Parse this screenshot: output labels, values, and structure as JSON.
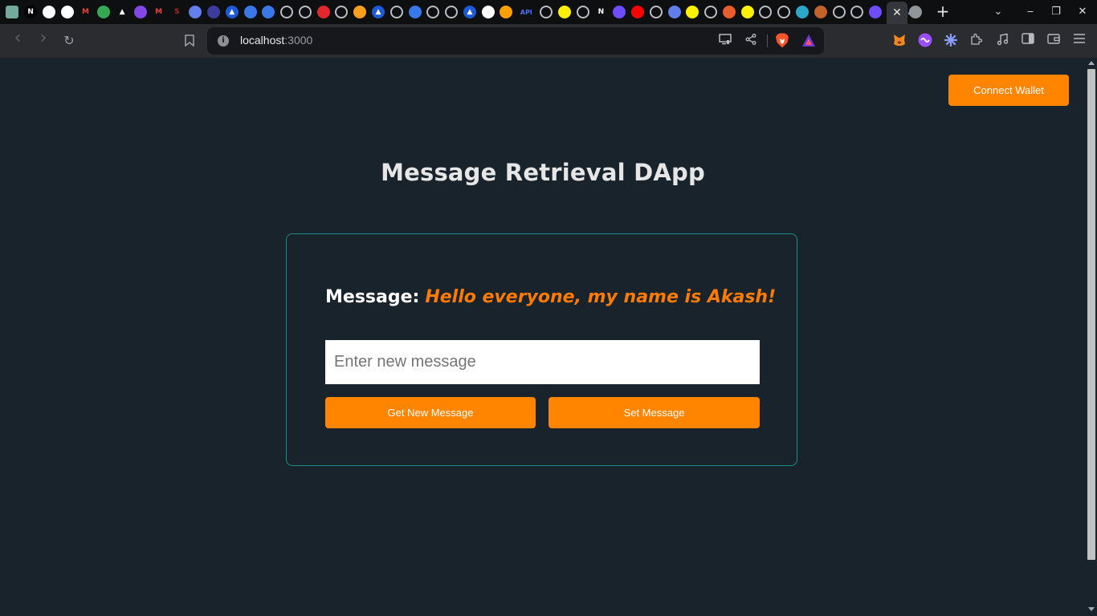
{
  "browser": {
    "tabs": {
      "favicons": [
        {
          "icon": "chatgpt-icon",
          "color": "#74aa9c",
          "glyph": ""
        },
        {
          "icon": "nextjs-icon",
          "color": "#000000",
          "glyph": "N"
        },
        {
          "icon": "github-icon",
          "color": "#ffffff",
          "glyph": ""
        },
        {
          "icon": "github-icon",
          "color": "#ffffff",
          "glyph": ""
        },
        {
          "icon": "gmail-icon",
          "color": "#ea4335",
          "glyph": "M"
        },
        {
          "icon": "chrome-dev-icon",
          "color": "#34a853",
          "glyph": ""
        },
        {
          "icon": "arweave-icon",
          "color": "#222222",
          "glyph": "▲"
        },
        {
          "icon": "polygon-icon",
          "color": "#8247e5",
          "glyph": ""
        },
        {
          "icon": "gmail-icon",
          "color": "#ea4335",
          "glyph": "M"
        },
        {
          "icon": "solidity-icon",
          "color": "#a52a2a",
          "glyph": "S"
        },
        {
          "icon": "ethereum-icon",
          "color": "#627eea",
          "glyph": ""
        },
        {
          "icon": "ethereum-icon",
          "color": "#3c3c9c",
          "glyph": ""
        },
        {
          "icon": "alchemy-icon",
          "color": "#1e5ad6",
          "glyph": "▲"
        },
        {
          "icon": "alchemy-icon",
          "color": "#3b78e7",
          "glyph": ""
        },
        {
          "icon": "alchemy-icon",
          "color": "#3b78e7",
          "glyph": ""
        },
        {
          "icon": "globe-icon",
          "color": "#b9bcc2",
          "glyph": ""
        },
        {
          "icon": "github-icon",
          "color": "#b9bcc2",
          "glyph": ""
        },
        {
          "icon": "roblox-icon",
          "color": "#e0282e",
          "glyph": ""
        },
        {
          "icon": "globe-icon",
          "color": "#b9bcc2",
          "glyph": ""
        },
        {
          "icon": "rainbow-icon",
          "color": "#ff9f1c",
          "glyph": ""
        },
        {
          "icon": "alchemy-icon",
          "color": "#1e5ad6",
          "glyph": "▲"
        },
        {
          "icon": "globe-icon",
          "color": "#b9bcc2",
          "glyph": ""
        },
        {
          "icon": "polygon-icon",
          "color": "#3b78e7",
          "glyph": ""
        },
        {
          "icon": "globe-icon",
          "color": "#b9bcc2",
          "glyph": ""
        },
        {
          "icon": "globe-icon",
          "color": "#b9bcc2",
          "glyph": ""
        },
        {
          "icon": "alchemy-icon",
          "color": "#1e5ad6",
          "glyph": "▲"
        },
        {
          "icon": "chart-icon",
          "color": "#ffffff",
          "glyph": ""
        },
        {
          "icon": "firebase-icon",
          "color": "#ffa000",
          "glyph": ""
        },
        {
          "icon": "api-icon",
          "color": "#4f6ef7",
          "glyph": "API"
        },
        {
          "icon": "github-icon",
          "color": "#b9bcc2",
          "glyph": ""
        },
        {
          "icon": "hardhat-icon",
          "color": "#fff100",
          "glyph": ""
        },
        {
          "icon": "github-icon",
          "color": "#b9bcc2",
          "glyph": ""
        },
        {
          "icon": "notion-icon",
          "color": "#ffffff",
          "glyph": "N"
        },
        {
          "icon": "graph-icon",
          "color": "#6f4cff",
          "glyph": ""
        },
        {
          "icon": "youtube-icon",
          "color": "#ff0000",
          "glyph": ""
        },
        {
          "icon": "globe-icon",
          "color": "#b9bcc2",
          "glyph": ""
        },
        {
          "icon": "ethereum-icon",
          "color": "#627eea",
          "glyph": ""
        },
        {
          "icon": "hardhat-icon",
          "color": "#fff100",
          "glyph": ""
        },
        {
          "icon": "loading-icon",
          "color": "#b9bcc2",
          "glyph": ""
        },
        {
          "icon": "chainlink-icon",
          "color": "#e85d2b",
          "glyph": ""
        },
        {
          "icon": "hardhat-icon",
          "color": "#fff100",
          "glyph": ""
        },
        {
          "icon": "globe-icon",
          "color": "#b9bcc2",
          "glyph": ""
        },
        {
          "icon": "globe-icon",
          "color": "#b9bcc2",
          "glyph": ""
        },
        {
          "icon": "eye-icon",
          "color": "#2aa7c9",
          "glyph": ""
        },
        {
          "icon": "ethereum-icon",
          "color": "#c1632a",
          "glyph": ""
        },
        {
          "icon": "globe-icon",
          "color": "#b9bcc2",
          "glyph": ""
        },
        {
          "icon": "globe-icon",
          "color": "#b9bcc2",
          "glyph": ""
        },
        {
          "icon": "graph-icon",
          "color": "#6f4cff",
          "glyph": ""
        },
        {
          "icon": "notion-icon",
          "color": "#ffffff",
          "glyph": "N"
        },
        {
          "icon": "speaker-icon",
          "color": "#ffffff",
          "glyph": "🔊"
        }
      ],
      "active_tab_close": "✕"
    },
    "new_tab": "+",
    "tab_search": "⌄",
    "window_controls": {
      "minimize": "‒",
      "maximize": "❐",
      "close": "✕"
    },
    "toolbar": {
      "back": "‹",
      "forward": "›",
      "reload": "↻",
      "bookmark": "🔖"
    },
    "address": {
      "host": "localhost",
      "port": ":3000",
      "info": "i"
    }
  },
  "page": {
    "connect_wallet": "Connect Wallet",
    "title": "Message Retrieval DApp",
    "message_label": "Message:",
    "message_value": "Hello everyone, my name is Akash!",
    "input_placeholder": "Enter new message",
    "get_button": "Get New Message",
    "set_button": "Set Message"
  },
  "colors": {
    "accent": "#ff8400",
    "message_value": "#ff7a00",
    "card_border": "#1a8a8a",
    "background": "#18232b"
  }
}
